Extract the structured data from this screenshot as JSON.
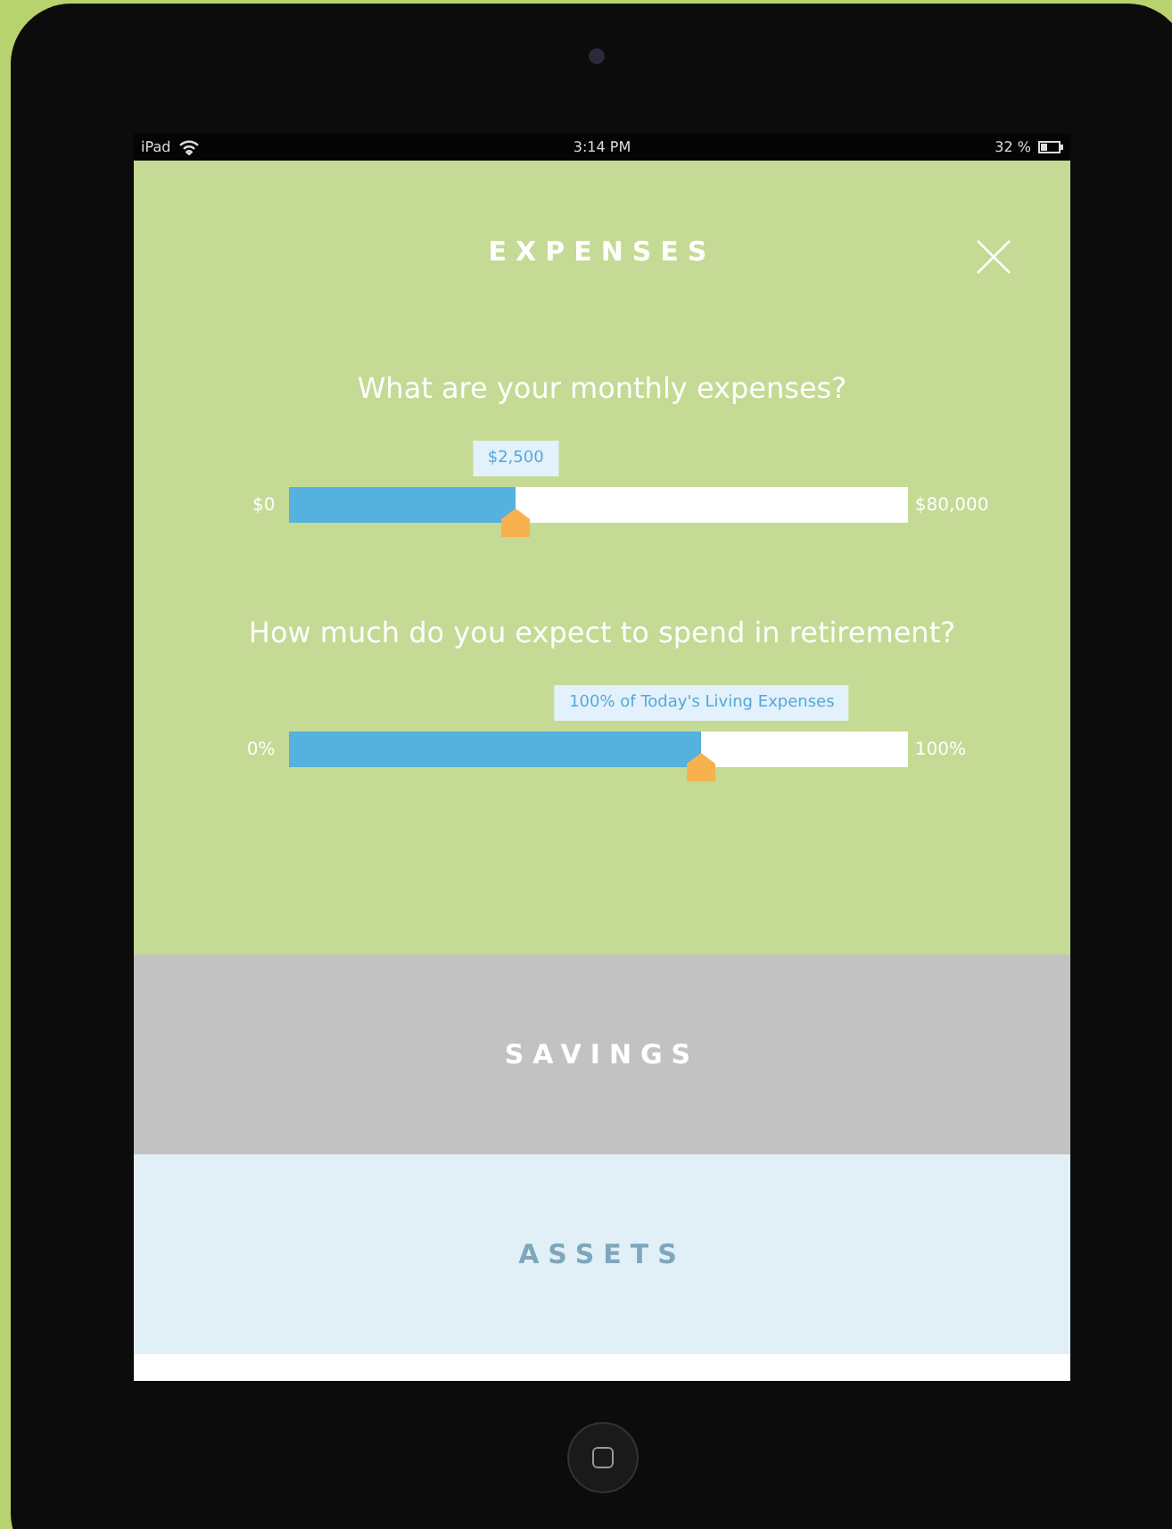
{
  "status_bar": {
    "device": "iPad",
    "time": "3:14 PM",
    "battery": "32 %"
  },
  "sections": [
    {
      "title": "EXPENSES",
      "color": "#c5da94",
      "expanded": true,
      "questions": [
        {
          "prompt": "What are your monthly expenses?",
          "min": "$0",
          "max": "$80,000",
          "value": "$2,500",
          "level": 0.366
        },
        {
          "prompt": "How much do you expect to spend in retirement?",
          "min": "0%",
          "max": "100%",
          "value": "100% of Today's Living Expenses",
          "level": 0.667
        }
      ]
    },
    {
      "title": "SAVINGS",
      "color": "#c2c2c2",
      "expanded": false
    },
    {
      "title": "ASSETS",
      "color": "#e1f0f7",
      "expanded": false
    }
  ]
}
